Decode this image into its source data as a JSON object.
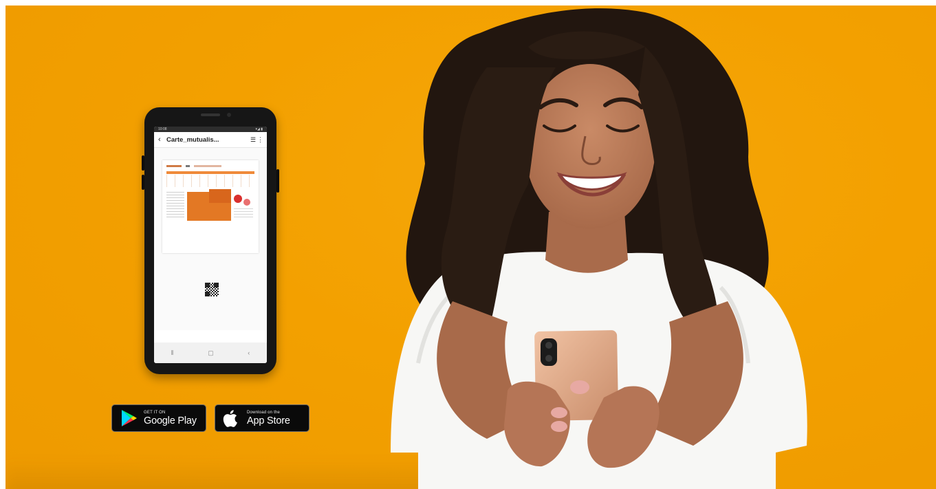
{
  "phone": {
    "doc_title": "Carte_mutualis...",
    "status_left": "10:08",
    "status_right": "▾◢ ▮"
  },
  "badges": {
    "google_play": {
      "small": "GET IT ON",
      "big": "Google Play"
    },
    "app_store": {
      "small": "Download on the",
      "big": "App Store"
    }
  },
  "colors": {
    "background": "#f3a000",
    "accent_orange": "#e37824",
    "shirt": "#f7f7f5",
    "hair": "#22160f"
  }
}
